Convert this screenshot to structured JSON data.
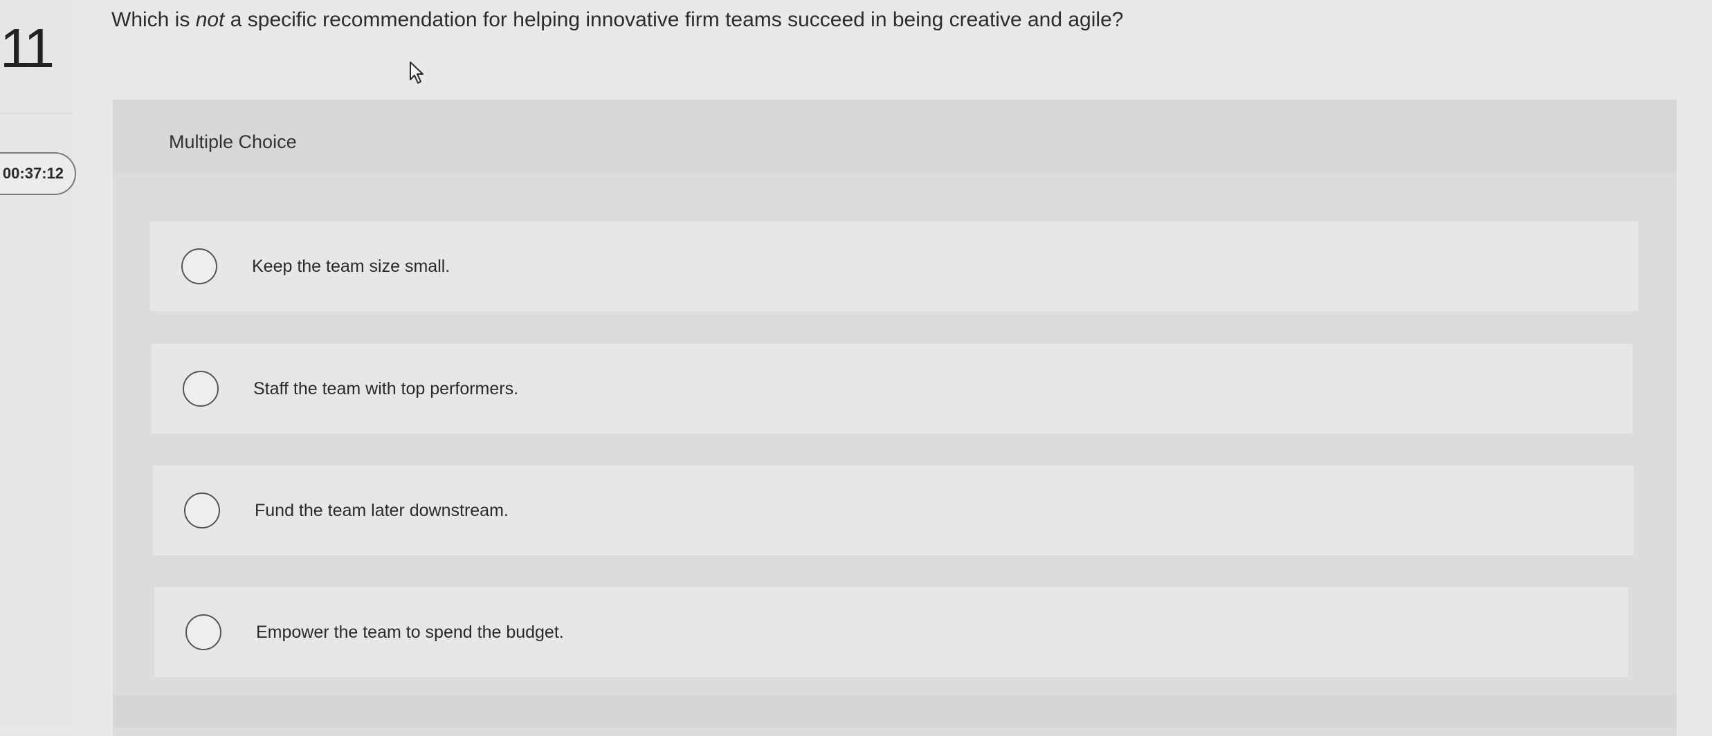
{
  "question": {
    "number": "11",
    "prompt_before": "Which is ",
    "prompt_emphasis": "not",
    "prompt_after": " a specific recommendation for helping innovative firm teams succeed in being creative and agile?"
  },
  "timer": {
    "value": "00:37:12"
  },
  "panel": {
    "label": "Multiple Choice"
  },
  "options": [
    {
      "label": "Keep the team size small.",
      "selected": false
    },
    {
      "label": "Staff the team with top performers.",
      "selected": false
    },
    {
      "label": "Fund the team later downstream.",
      "selected": false
    },
    {
      "label": "Empower the team to spend the budget.",
      "selected": false
    }
  ],
  "icons": {
    "cursor": "mouse-pointer-icon",
    "radio": "radio-unchecked-icon"
  },
  "colors": {
    "background": "#e9e9e7",
    "panel": "#dcdcda",
    "option_background": "#e7e7e5",
    "text": "#2a2a2a"
  }
}
